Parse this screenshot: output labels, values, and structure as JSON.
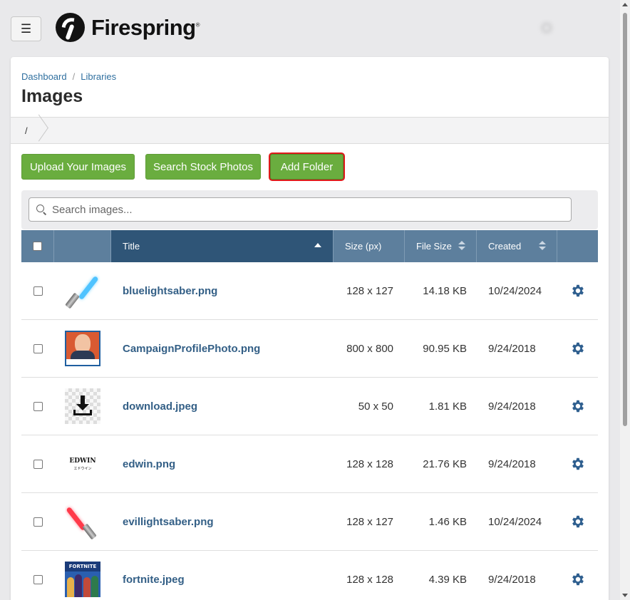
{
  "header": {
    "menu_icon": "hamburger-icon",
    "brand": "Firespring",
    "brand_mark": "®"
  },
  "breadcrumb": [
    "Dashboard",
    "Libraries"
  ],
  "breadcrumb_sep": "/",
  "page_title": "Images",
  "path": "/",
  "buttons": {
    "upload": "Upload Your Images",
    "stock": "Search Stock Photos",
    "folder": "Add Folder"
  },
  "search": {
    "placeholder": "Search images...",
    "value": ""
  },
  "columns": {
    "title": "Title",
    "size": "Size (px)",
    "file_size": "File Size",
    "created": "Created"
  },
  "rows": [
    {
      "title": "bluelightsaber.png",
      "size": "128 x 127",
      "file_size": "14.18 KB",
      "created": "10/24/2024",
      "thumb": "blue-lightsaber"
    },
    {
      "title": "CampaignProfilePhoto.png",
      "size": "800 x 800",
      "file_size": "90.95 KB",
      "created": "9/24/2018",
      "thumb": "profile-photo"
    },
    {
      "title": "download.jpeg",
      "size": "50 x 50",
      "file_size": "1.81 KB",
      "created": "9/24/2018",
      "thumb": "download-icon"
    },
    {
      "title": "edwin.png",
      "size": "128 x 128",
      "file_size": "21.76 KB",
      "created": "9/24/2018",
      "thumb": "edwin-logo",
      "thumb_text": "EDWIN",
      "thumb_subtext": "エドウイン"
    },
    {
      "title": "evillightsaber.png",
      "size": "128 x 127",
      "file_size": "1.46 KB",
      "created": "10/24/2024",
      "thumb": "red-lightsaber"
    },
    {
      "title": "fortnite.jpeg",
      "size": "128 x 128",
      "file_size": "4.39 KB",
      "created": "9/24/2018",
      "thumb": "fortnite-poster",
      "thumb_text": "FORTNITE"
    }
  ],
  "colors": {
    "button_green": "#6aad3f",
    "header_blue": "#5d7f9d",
    "active_header": "#2f5577",
    "link_blue": "#335f86",
    "highlight_red": "#e01a1a",
    "blue_blade": "#4fc3ff",
    "red_blade": "#ff3a4a"
  }
}
